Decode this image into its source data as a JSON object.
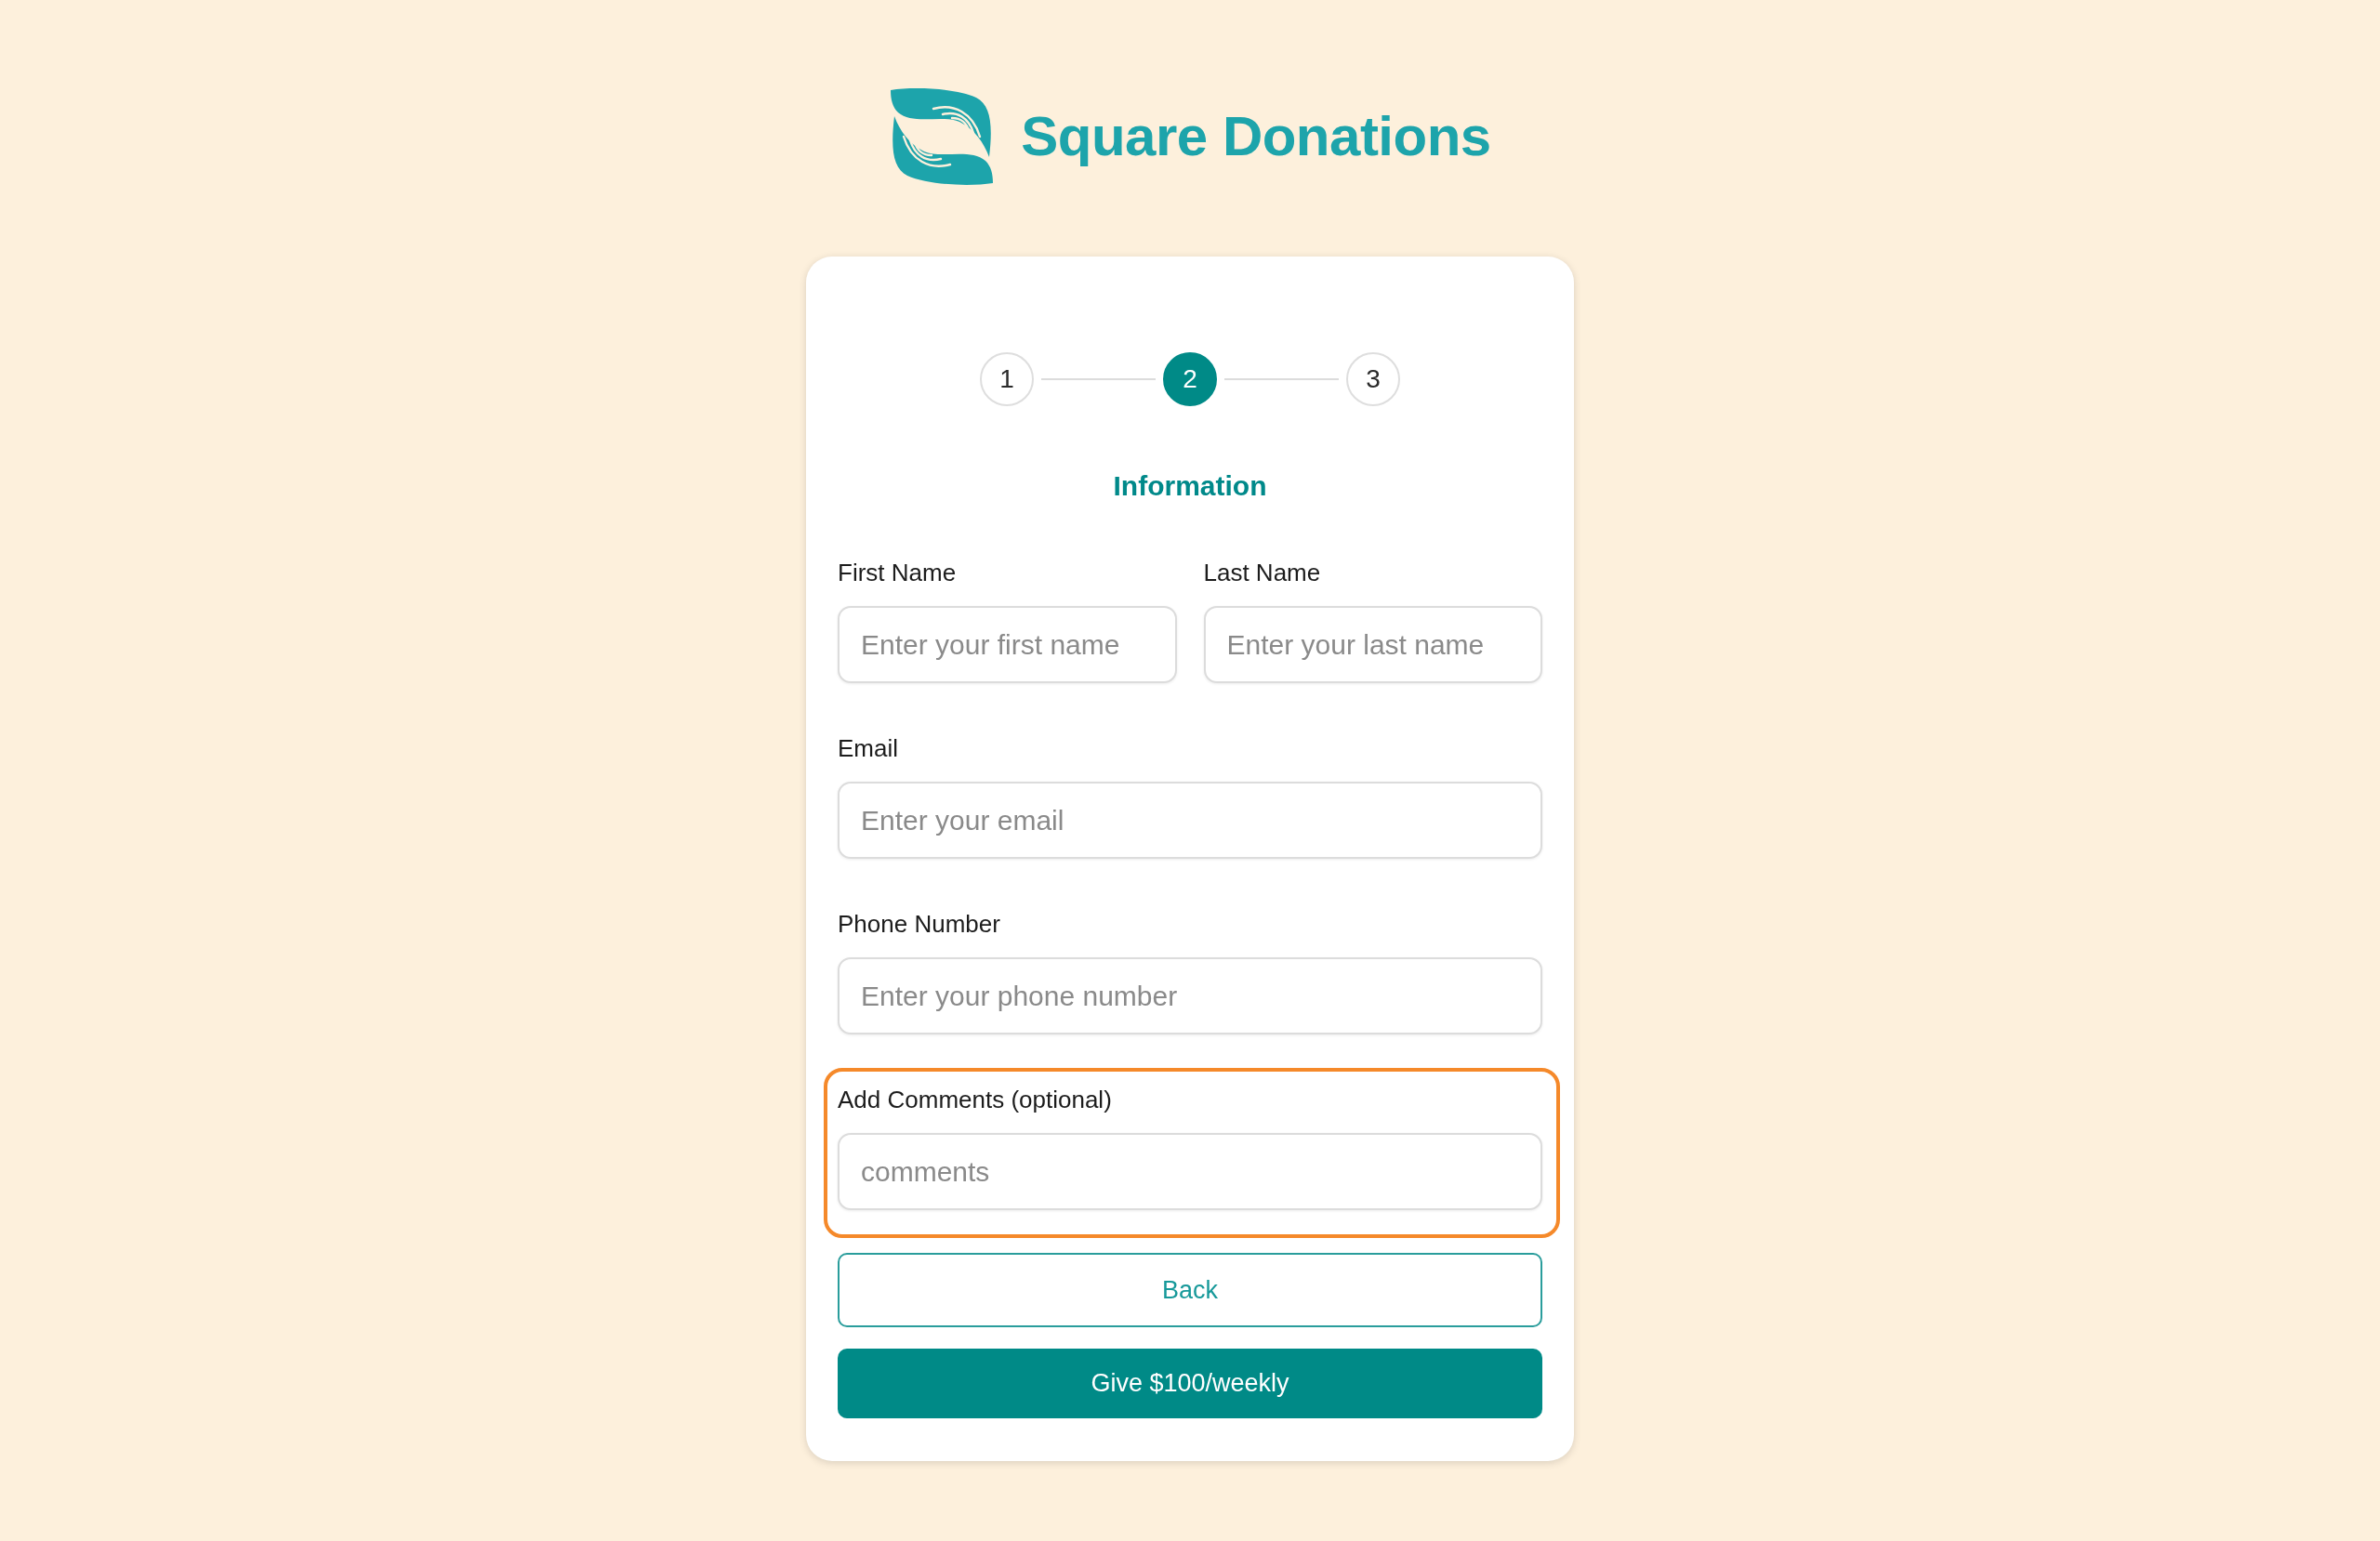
{
  "logo": {
    "name": "Square Donations"
  },
  "stepper": {
    "steps": [
      {
        "label": "1",
        "selected": false
      },
      {
        "label": "2",
        "selected": true
      },
      {
        "label": "3",
        "selected": false
      }
    ]
  },
  "section_title": "Information",
  "rows": [
    {
      "fields": [
        {
          "label": "First Name",
          "placeholder": "Enter your first name",
          "highlighted": false
        },
        {
          "label": "Last Name",
          "placeholder": "Enter your last name",
          "highlighted": false
        }
      ]
    },
    {
      "fields": [
        {
          "label": "Email",
          "placeholder": "Enter your email",
          "highlighted": false
        }
      ]
    },
    {
      "fields": [
        {
          "label": "Phone Number",
          "placeholder": "Enter your phone number",
          "highlighted": false
        }
      ]
    },
    {
      "fields": [
        {
          "label": "Add Comments (optional)",
          "placeholder": "comments",
          "highlighted": true
        }
      ]
    }
  ],
  "buttons": [
    {
      "label": "Back",
      "kind": "outline"
    },
    {
      "label": "Give $100/weekly",
      "kind": "primary"
    }
  ]
}
